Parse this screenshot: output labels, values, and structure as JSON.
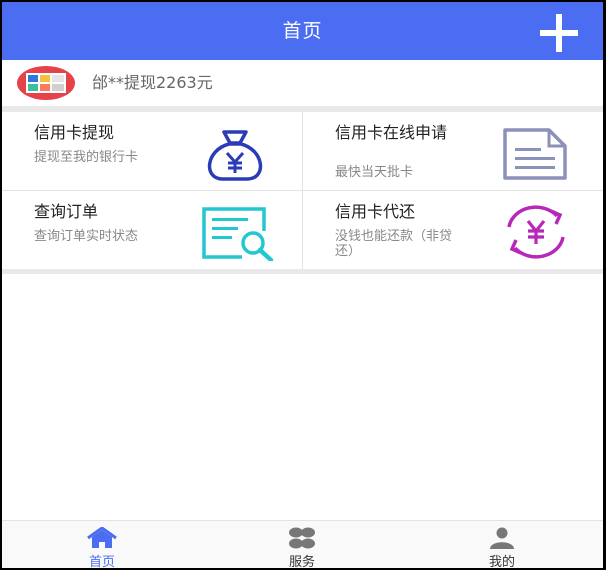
{
  "header": {
    "title": "首页",
    "add_icon": "plus-icon"
  },
  "notice": {
    "text": "邰**提现2263元",
    "icon": "card-thumbnail-icon"
  },
  "services": [
    {
      "title": "信用卡提现",
      "subtitle": "提现至我的银行卡",
      "icon": "money-bag-yen-icon",
      "color": "#2b3db6"
    },
    {
      "title": "信用卡在线申请",
      "subtitle": "最快当天批卡",
      "icon": "document-icon",
      "color": "#8b91b8"
    },
    {
      "title": "查询订单",
      "subtitle": "查询订单实时状态",
      "icon": "search-document-icon",
      "color": "#23c7d0"
    },
    {
      "title": "信用卡代还",
      "subtitle": "没钱也能还款（非贷还）",
      "icon": "yen-cycle-icon",
      "color": "#b628b8"
    }
  ],
  "tabbar": {
    "items": [
      {
        "label": "首页",
        "icon": "home-icon",
        "active": true
      },
      {
        "label": "服务",
        "icon": "grid-icon",
        "active": false
      },
      {
        "label": "我的",
        "icon": "user-icon",
        "active": false
      }
    ],
    "active_color": "#4a6df2"
  },
  "colors": {
    "header": "#4a6df2",
    "separator": "#e9e9e9"
  }
}
